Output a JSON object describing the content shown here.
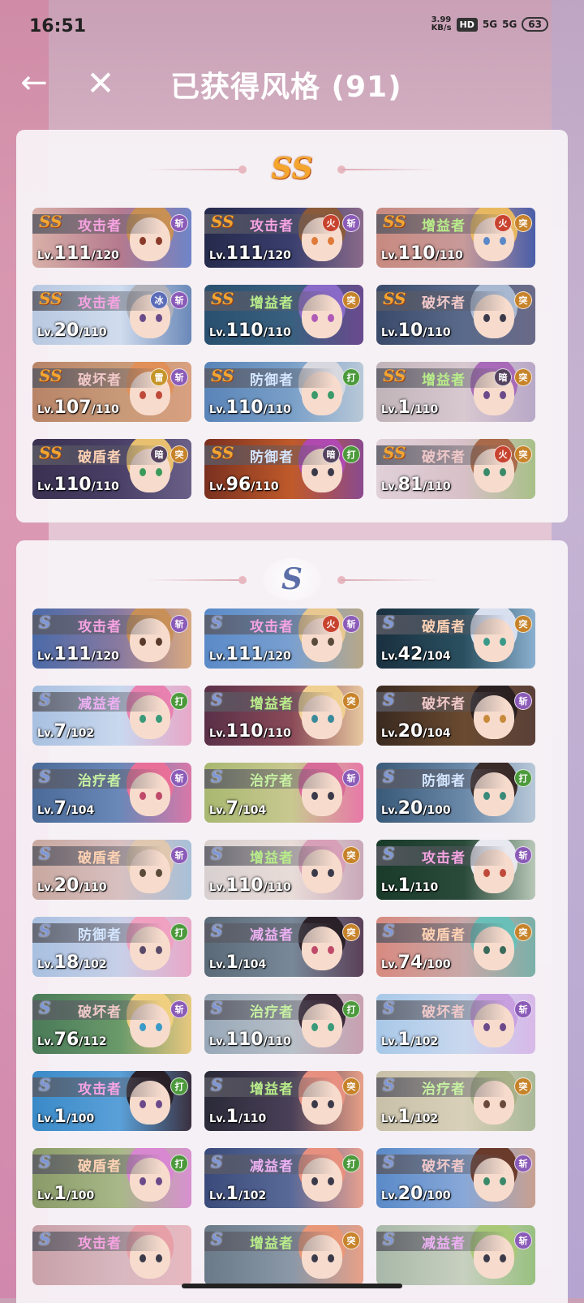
{
  "status_bar": {
    "time": "16:51",
    "net_speed_value": "3.99",
    "net_speed_unit": "KB/s",
    "hd_label": "HD",
    "signal1": "5G",
    "signal2": "5G",
    "battery": "63"
  },
  "header": {
    "title": "已获得风格 (91)",
    "back_icon": "←",
    "close_icon": "✕"
  },
  "sections": [
    {
      "rank": "SS",
      "cards": [
        {
          "rank": "SS",
          "role": "攻击者",
          "role_color": "c-attack",
          "attrs": [
            [
              "斩",
              "a-zhan"
            ]
          ],
          "lv": "111",
          "max": "/120",
          "bg": "linear-gradient(90deg,#d8b0a8,#b57a8e 55%,#6e84c8)",
          "hair": "#c89054",
          "eye": "#8a3a2a"
        },
        {
          "rank": "SS",
          "role": "攻击者",
          "role_color": "c-attack",
          "attrs": [
            [
              "火",
              "a-huo"
            ],
            [
              "斩",
              "a-zhan"
            ]
          ],
          "lv": "111",
          "max": "/120",
          "bg": "linear-gradient(90deg,#262a4c,#3a3f6e 55%,#8a6a8a)",
          "hair": "#8a5a3a",
          "eye": "#e07a3a"
        },
        {
          "rank": "SS",
          "role": "增益者",
          "role_color": "c-buff",
          "attrs": [
            [
              "火",
              "a-huo"
            ],
            [
              "突",
              "a-tu"
            ]
          ],
          "lv": "110",
          "max": "/110",
          "bg": "linear-gradient(90deg,#c88a80,#c89a9a 55%,#4a5ea8)",
          "hair": "#e8b860",
          "eye": "#5a88c8"
        },
        {
          "rank": "SS",
          "role": "攻击者",
          "role_color": "c-attack",
          "attrs": [
            [
              "冰",
              "a-bing"
            ],
            [
              "斩",
              "a-zhan"
            ]
          ],
          "lv": "20",
          "max": "/110",
          "bg": "linear-gradient(90deg,#b8c8e0,#d0dcee 55%,#6a88b8)",
          "hair": "#b0b0b8",
          "eye": "#6a4a8a"
        },
        {
          "rank": "SS",
          "role": "增益者",
          "role_color": "c-buff",
          "attrs": [
            [
              "突",
              "a-tu"
            ]
          ],
          "lv": "110",
          "max": "/110",
          "bg": "linear-gradient(90deg,#2a5070,#3a6080 55%,#6a4a8e)",
          "hair": "#8a6ac8",
          "eye": "#b05ab8"
        },
        {
          "rank": "SS",
          "role": "破坏者",
          "role_color": "c-break",
          "attrs": [
            [
              "突",
              "a-tu"
            ]
          ],
          "lv": "10",
          "max": "/110",
          "bg": "linear-gradient(90deg,#3a4a6a,#5a6a8a 55%,#6a6a88)",
          "hair": "#a8b8d0",
          "eye": "#3a3a4a"
        },
        {
          "rank": "SS",
          "role": "破坏者",
          "role_color": "c-break",
          "attrs": [
            [
              "雷",
              "a-lei"
            ],
            [
              "斩",
              "a-zhan"
            ]
          ],
          "lv": "107",
          "max": "/110",
          "bg": "linear-gradient(90deg,#b88468,#c89a78 55%,#d8a080)",
          "hair": "#e09058",
          "eye": "#c04a3a"
        },
        {
          "rank": "SS",
          "role": "防御者",
          "role_color": "c-def",
          "attrs": [
            [
              "打",
              "a-da"
            ]
          ],
          "lv": "110",
          "max": "/110",
          "bg": "linear-gradient(90deg,#5a84b8,#7aa0c8 55%,#b8c8d8)",
          "hair": "#d8d8e0",
          "eye": "#3a9a6a"
        },
        {
          "rank": "SS",
          "role": "增益者",
          "role_color": "c-buff",
          "attrs": [
            [
              "暗",
              "a-an"
            ],
            [
              "突",
              "a-tu"
            ]
          ],
          "lv": "1",
          "max": "/110",
          "bg": "linear-gradient(90deg,#c0b4b8,#d8c8d0 55%,#b8a8c8)",
          "hair": "#a86ab8",
          "eye": "#6a4a8a"
        },
        {
          "rank": "SS",
          "role": "破盾者",
          "role_color": "c-shield",
          "attrs": [
            [
              "暗",
              "a-an"
            ],
            [
              "突",
              "a-tu"
            ]
          ],
          "lv": "110",
          "max": "/110",
          "bg": "linear-gradient(90deg,#3a3050,#4a4068 55%,#6a6088)",
          "hair": "#e8c070",
          "eye": "#3a9a5a"
        },
        {
          "rank": "SS",
          "role": "防御者",
          "role_color": "c-def",
          "attrs": [
            [
              "暗",
              "a-an"
            ],
            [
              "打",
              "a-da"
            ]
          ],
          "lv": "96",
          "max": "/110",
          "bg": "linear-gradient(90deg,#7a3020,#c05a2a 55%,#8a4a8e)",
          "hair": "#b04ab0",
          "eye": "#3a3a4a"
        },
        {
          "rank": "SS",
          "role": "破坏者",
          "role_color": "c-break",
          "attrs": [
            [
              "火",
              "a-huo"
            ],
            [
              "突",
              "a-tu"
            ]
          ],
          "lv": "81",
          "max": "/110",
          "bg": "linear-gradient(90deg,#e0d0d8,#d8c0c8 55%,#a8c088)",
          "hair": "#a86a4a",
          "eye": "#3a8a6a"
        }
      ]
    },
    {
      "rank": "S",
      "cards": [
        {
          "rank": "S",
          "role": "攻击者",
          "role_color": "c-attack",
          "attrs": [
            [
              "斩",
              "a-zhan"
            ]
          ],
          "lv": "111",
          "max": "/120",
          "bg": "linear-gradient(90deg,#4a6aa8,#8a7aa0 55%,#d8a880)",
          "hair": "#c89058",
          "eye": "#5a3a2a"
        },
        {
          "rank": "S",
          "role": "攻击者",
          "role_color": "c-attack",
          "attrs": [
            [
              "火",
              "a-huo"
            ],
            [
              "斩",
              "a-zhan"
            ]
          ],
          "lv": "111",
          "max": "/120",
          "bg": "linear-gradient(90deg,#5a8ac8,#7aa0d0 55%,#b8a888)",
          "hair": "#e8c890",
          "eye": "#5a4a3a"
        },
        {
          "rank": "S",
          "role": "破盾者",
          "role_color": "c-shield",
          "attrs": [
            [
              "突",
              "a-tu"
            ]
          ],
          "lv": "42",
          "max": "/104",
          "bg": "linear-gradient(90deg,#1a3040,#2a5060 55%,#8ab0d0)",
          "hair": "#d8e0f0",
          "eye": "#3a9a8a"
        },
        {
          "rank": "S",
          "role": "减益者",
          "role_color": "c-debuff",
          "attrs": [
            [
              "打",
              "a-da"
            ]
          ],
          "lv": "7",
          "max": "/102",
          "bg": "linear-gradient(90deg,#a8c0e0,#c8d8ee 55%,#e8a8c8)",
          "hair": "#e880b0",
          "eye": "#3a9a7a"
        },
        {
          "rank": "S",
          "role": "增益者",
          "role_color": "c-buff",
          "attrs": [
            [
              "突",
              "a-tu"
            ]
          ],
          "lv": "110",
          "max": "/110",
          "bg": "linear-gradient(90deg,#5a3048,#8a4a58 55%,#e8c8a0)",
          "hair": "#f0d090",
          "eye": "#3a8a9a"
        },
        {
          "rank": "S",
          "role": "破坏者",
          "role_color": "c-break",
          "attrs": [
            [
              "斩",
              "a-zhan"
            ]
          ],
          "lv": "20",
          "max": "/104",
          "bg": "linear-gradient(90deg,#3a2a20,#6a4a30 55%,#5a4038)",
          "hair": "#2a2020",
          "eye": "#c88a3a"
        },
        {
          "rank": "S",
          "role": "治疗者",
          "role_color": "c-heal",
          "attrs": [
            [
              "斩",
              "a-zhan"
            ]
          ],
          "lv": "7",
          "max": "/104",
          "bg": "linear-gradient(90deg,#4a6a98,#6a88b8 55%,#d878a8)",
          "hair": "#e87098",
          "eye": "#c04a6a"
        },
        {
          "rank": "S",
          "role": "治疗者",
          "role_color": "c-heal",
          "attrs": [
            [
              "斩",
              "a-zhan"
            ]
          ],
          "lv": "7",
          "max": "/104",
          "bg": "linear-gradient(90deg,#a8b870,#c8c890 55%,#e878a8)",
          "hair": "#d86a98",
          "eye": "#3a3a4a"
        },
        {
          "rank": "S",
          "role": "防御者",
          "role_color": "c-def",
          "attrs": [
            [
              "打",
              "a-da"
            ]
          ],
          "lv": "20",
          "max": "/100",
          "bg": "linear-gradient(90deg,#3a5a7a,#6a88a8 55%,#b8c8d8)",
          "hair": "#3a2a28",
          "eye": "#3a8a7a"
        },
        {
          "rank": "S",
          "role": "破盾者",
          "role_color": "c-shield",
          "attrs": [
            [
              "斩",
              "a-zhan"
            ]
          ],
          "lv": "20",
          "max": "/110",
          "bg": "linear-gradient(90deg,#c8a8a0,#d8c0c0 55%,#a8c0d8)",
          "hair": "#e0c8b0",
          "eye": "#5a4a3a"
        },
        {
          "rank": "S",
          "role": "增益者",
          "role_color": "c-buff",
          "attrs": [
            [
              "突",
              "a-tu"
            ]
          ],
          "lv": "110",
          "max": "/110",
          "bg": "linear-gradient(90deg,#d8d0d0,#e8dcd8 55%,#c8a8b8)",
          "hair": "#d8a0b8",
          "eye": "#3a3a4a"
        },
        {
          "rank": "S",
          "role": "攻击者",
          "role_color": "c-attack",
          "attrs": [
            [
              "斩",
              "a-zhan"
            ]
          ],
          "lv": "1",
          "max": "/110",
          "bg": "linear-gradient(90deg,#1a3a2a,#2a4a3a 55%,#b8c8b8)",
          "hair": "#e8e8f0",
          "eye": "#c04a3a"
        },
        {
          "rank": "S",
          "role": "防御者",
          "role_color": "c-def",
          "attrs": [
            [
              "打",
              "a-da"
            ]
          ],
          "lv": "18",
          "max": "/102",
          "bg": "linear-gradient(90deg,#a8c0e0,#c8d0e8 55%,#e8a8c8)",
          "hair": "#f0a0c0",
          "eye": "#5a4a6a"
        },
        {
          "rank": "S",
          "role": "减益者",
          "role_color": "c-debuff",
          "attrs": [
            [
              "突",
              "a-tu"
            ]
          ],
          "lv": "1",
          "max": "/104",
          "bg": "linear-gradient(90deg,#5a6a78,#788898 55%,#5a4058)",
          "hair": "#2a2028",
          "eye": "#c04a6a"
        },
        {
          "rank": "S",
          "role": "破盾者",
          "role_color": "c-shield",
          "attrs": [
            [
              "突",
              "a-tu"
            ]
          ],
          "lv": "74",
          "max": "/100",
          "bg": "linear-gradient(90deg,#d88a80,#c8a8a8 55%,#7ab0a8)",
          "hair": "#6ac0b8",
          "eye": "#3a6a5a"
        },
        {
          "rank": "S",
          "role": "破坏者",
          "role_color": "c-break",
          "attrs": [
            [
              "斩",
              "a-zhan"
            ]
          ],
          "lv": "76",
          "max": "/112",
          "bg": "linear-gradient(90deg,#4a7a58,#6a9a6a 55%,#e8c880)",
          "hair": "#f0d080",
          "eye": "#3a9ac8"
        },
        {
          "rank": "S",
          "role": "治疗者",
          "role_color": "c-heal",
          "attrs": [
            [
              "打",
              "a-da"
            ]
          ],
          "lv": "110",
          "max": "/110",
          "bg": "linear-gradient(90deg,#98a8b8,#b8c0c8 55%,#c8a0b0)",
          "hair": "#3a2a38",
          "eye": "#3a9a7a"
        },
        {
          "rank": "S",
          "role": "破坏者",
          "role_color": "c-break",
          "attrs": [
            [
              "斩",
              "a-zhan"
            ]
          ],
          "lv": "1",
          "max": "/102",
          "bg": "linear-gradient(90deg,#a8c8e8,#c8d8ee 55%,#d8b8e8)",
          "hair": "#c8a0e0",
          "eye": "#6a4a8a"
        },
        {
          "rank": "S",
          "role": "攻击者",
          "role_color": "c-attack",
          "attrs": [
            [
              "打",
              "a-da"
            ]
          ],
          "lv": "1",
          "max": "/100",
          "bg": "linear-gradient(90deg,#3a8ac8,#5aa0d8 55%,#3a3040)",
          "hair": "#2a2028",
          "eye": "#6a4a8a"
        },
        {
          "rank": "S",
          "role": "增益者",
          "role_color": "c-buff",
          "attrs": [
            [
              "突",
              "a-tu"
            ]
          ],
          "lv": "1",
          "max": "/110",
          "bg": "linear-gradient(90deg,#2a2a38,#4a4058 55%,#e8a088)",
          "hair": "#e89080",
          "eye": "#3a3a4a"
        },
        {
          "rank": "S",
          "role": "治疗者",
          "role_color": "c-heal",
          "attrs": [
            [
              "突",
              "a-tu"
            ]
          ],
          "lv": "1",
          "max": "/102",
          "bg": "linear-gradient(90deg,#c8c0a8,#d8d0b8 55%,#a8b898)",
          "hair": "#a8b088",
          "eye": "#6a4a3a"
        },
        {
          "rank": "S",
          "role": "破盾者",
          "role_color": "c-shield",
          "attrs": [
            [
              "打",
              "a-da"
            ]
          ],
          "lv": "1",
          "max": "/100",
          "bg": "linear-gradient(90deg,#8a9a68,#a8b888 55%,#d890d0)",
          "hair": "#d888d0",
          "eye": "#6a4a8a"
        },
        {
          "rank": "S",
          "role": "减益者",
          "role_color": "c-debuff",
          "attrs": [
            [
              "打",
              "a-da"
            ]
          ],
          "lv": "1",
          "max": "/102",
          "bg": "linear-gradient(90deg,#3a4a7a,#5a6a98 55%,#e8a090)",
          "hair": "#e89080",
          "eye": "#3a3a4a"
        },
        {
          "rank": "S",
          "role": "破坏者",
          "role_color": "c-break",
          "attrs": [
            [
              "斩",
              "a-zhan"
            ]
          ],
          "lv": "20",
          "max": "/100",
          "bg": "linear-gradient(90deg,#5a8ac8,#88a8d8 55%,#c8a090)",
          "hair": "#6a3a2a",
          "eye": "#3a8a6a"
        },
        {
          "rank": "S",
          "role": "攻击者",
          "role_color": "c-attack",
          "attrs": [],
          "lv": "",
          "max": "",
          "bg": "linear-gradient(90deg,#c8a0a8,#d8b8c0 55%,#e8b8c0)",
          "hair": "#e8a0a8",
          "eye": "#3a3a4a"
        },
        {
          "rank": "S",
          "role": "增益者",
          "role_color": "c-buff",
          "attrs": [
            [
              "突",
              "a-tu"
            ]
          ],
          "lv": "",
          "max": "",
          "bg": "linear-gradient(90deg,#6a7a88,#8a98a8 55%,#e8a088)",
          "hair": "#e89878",
          "eye": "#3a3a4a"
        },
        {
          "rank": "S",
          "role": "减益者",
          "role_color": "c-debuff",
          "attrs": [
            [
              "斩",
              "a-zhan"
            ]
          ],
          "lv": "",
          "max": "",
          "bg": "linear-gradient(90deg,#a8b8a8,#c8d0c0 55%,#98c080)",
          "hair": "#a8c878",
          "eye": "#3a3a4a"
        }
      ]
    }
  ],
  "lv_prefix": "Lv."
}
